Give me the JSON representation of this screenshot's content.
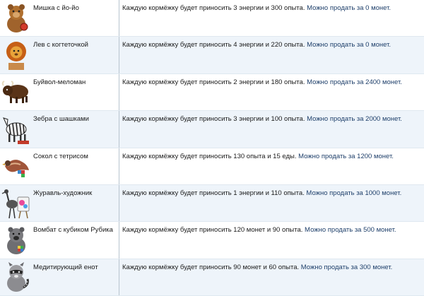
{
  "rows": [
    {
      "icon": "bear-yoyo-icon",
      "name": "Мишка с йо-йо",
      "desc_a": "Каждую кормёжку будет приносить 3 энергии и 300 опыта.",
      "desc_b": " Можно продать за 0 монет."
    },
    {
      "icon": "lion-scratcher-icon",
      "name": "Лев с когтеточкой",
      "desc_a": "Каждую кормёжку будет приносить 4 энергии и 220 опыта.",
      "desc_b": " Можно продать за 0 монет."
    },
    {
      "icon": "buffalo-icon",
      "name": "Буйвол-меломан",
      "desc_a": "Каждую кормёжку будет приносить 2 энергии и 180 опыта.",
      "desc_b": " Можно продать за 2400 монет."
    },
    {
      "icon": "zebra-icon",
      "name": "Зебра с шашками",
      "desc_a": "Каждую кормёжку будет приносить 3 энергии и 100 опыта.",
      "desc_b": " Можно продать за 2000 монет."
    },
    {
      "icon": "falcon-icon",
      "name": "Сокол с тетрисом",
      "desc_a": "Каждую кормёжку будет приносить 130 опыта и 15 еды.",
      "desc_b": " Можно продать за 1200 монет."
    },
    {
      "icon": "crane-artist-icon",
      "name": "Журавль-художник",
      "desc_a": "Каждую кормёжку будет приносить 1 энергии и 110 опыта.",
      "desc_b": " Можно продать за 1000 монет."
    },
    {
      "icon": "wombat-icon",
      "name": "Вомбат с кубиком Рубика",
      "desc_a": "Каждую кормёжку будет приносить 120 монет и 90 опыта.",
      "desc_b": " Можно продать за 500 монет."
    },
    {
      "icon": "raccoon-icon",
      "name": "Медитирующий енот",
      "desc_a": "Каждую кормёжку будет приносить 90 монет и 60 опыта.",
      "desc_b": " Можно продать за 300 монет."
    }
  ]
}
